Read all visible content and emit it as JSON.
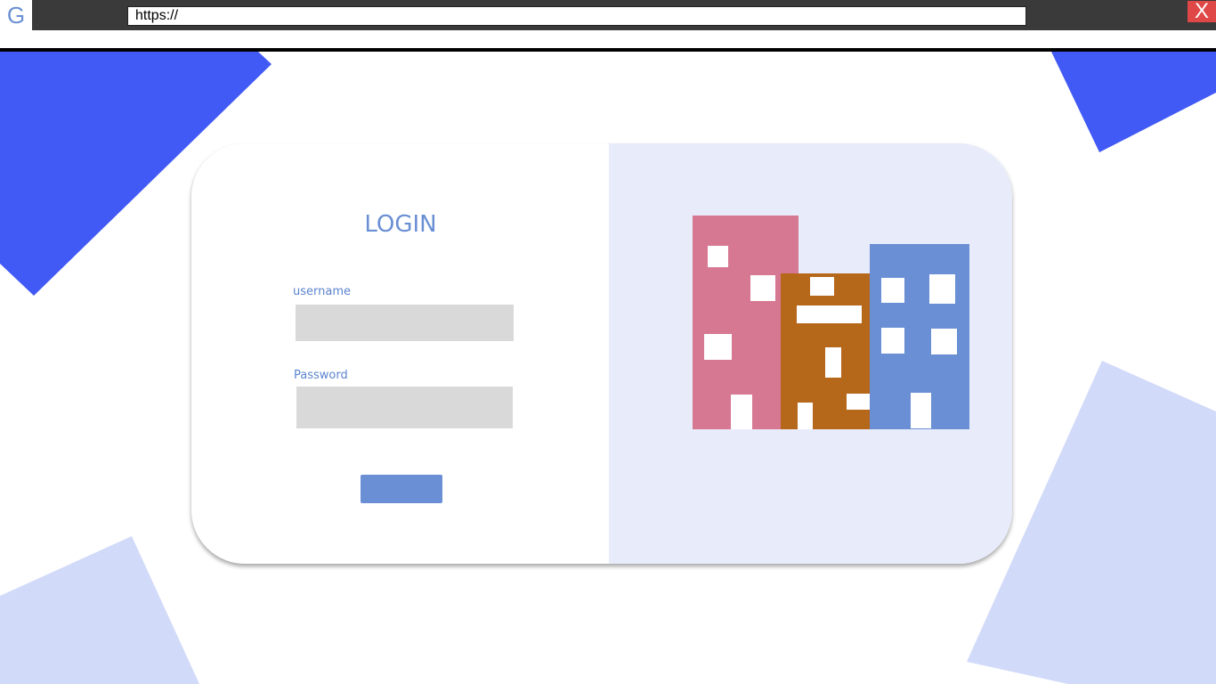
{
  "browser": {
    "logo_letter": "G",
    "url_value": "https://",
    "close_label": "X"
  },
  "login": {
    "title": "LOGIN",
    "username_label": "username",
    "username_value": "",
    "password_label": "Password",
    "password_value": "",
    "submit_label": ""
  },
  "colors": {
    "accent": "#6a8fd4",
    "bg_shape_dark": "#425af5",
    "bg_shape_light": "#d2daf9",
    "panel_bg": "#e8ebfa",
    "input_bg": "#d9d9d9",
    "building_pink": "#d67892",
    "building_orange": "#b5671a",
    "building_blue": "#6a8fd4",
    "close_red": "#e04848"
  },
  "illustration": {
    "name": "city-buildings-illustration"
  }
}
